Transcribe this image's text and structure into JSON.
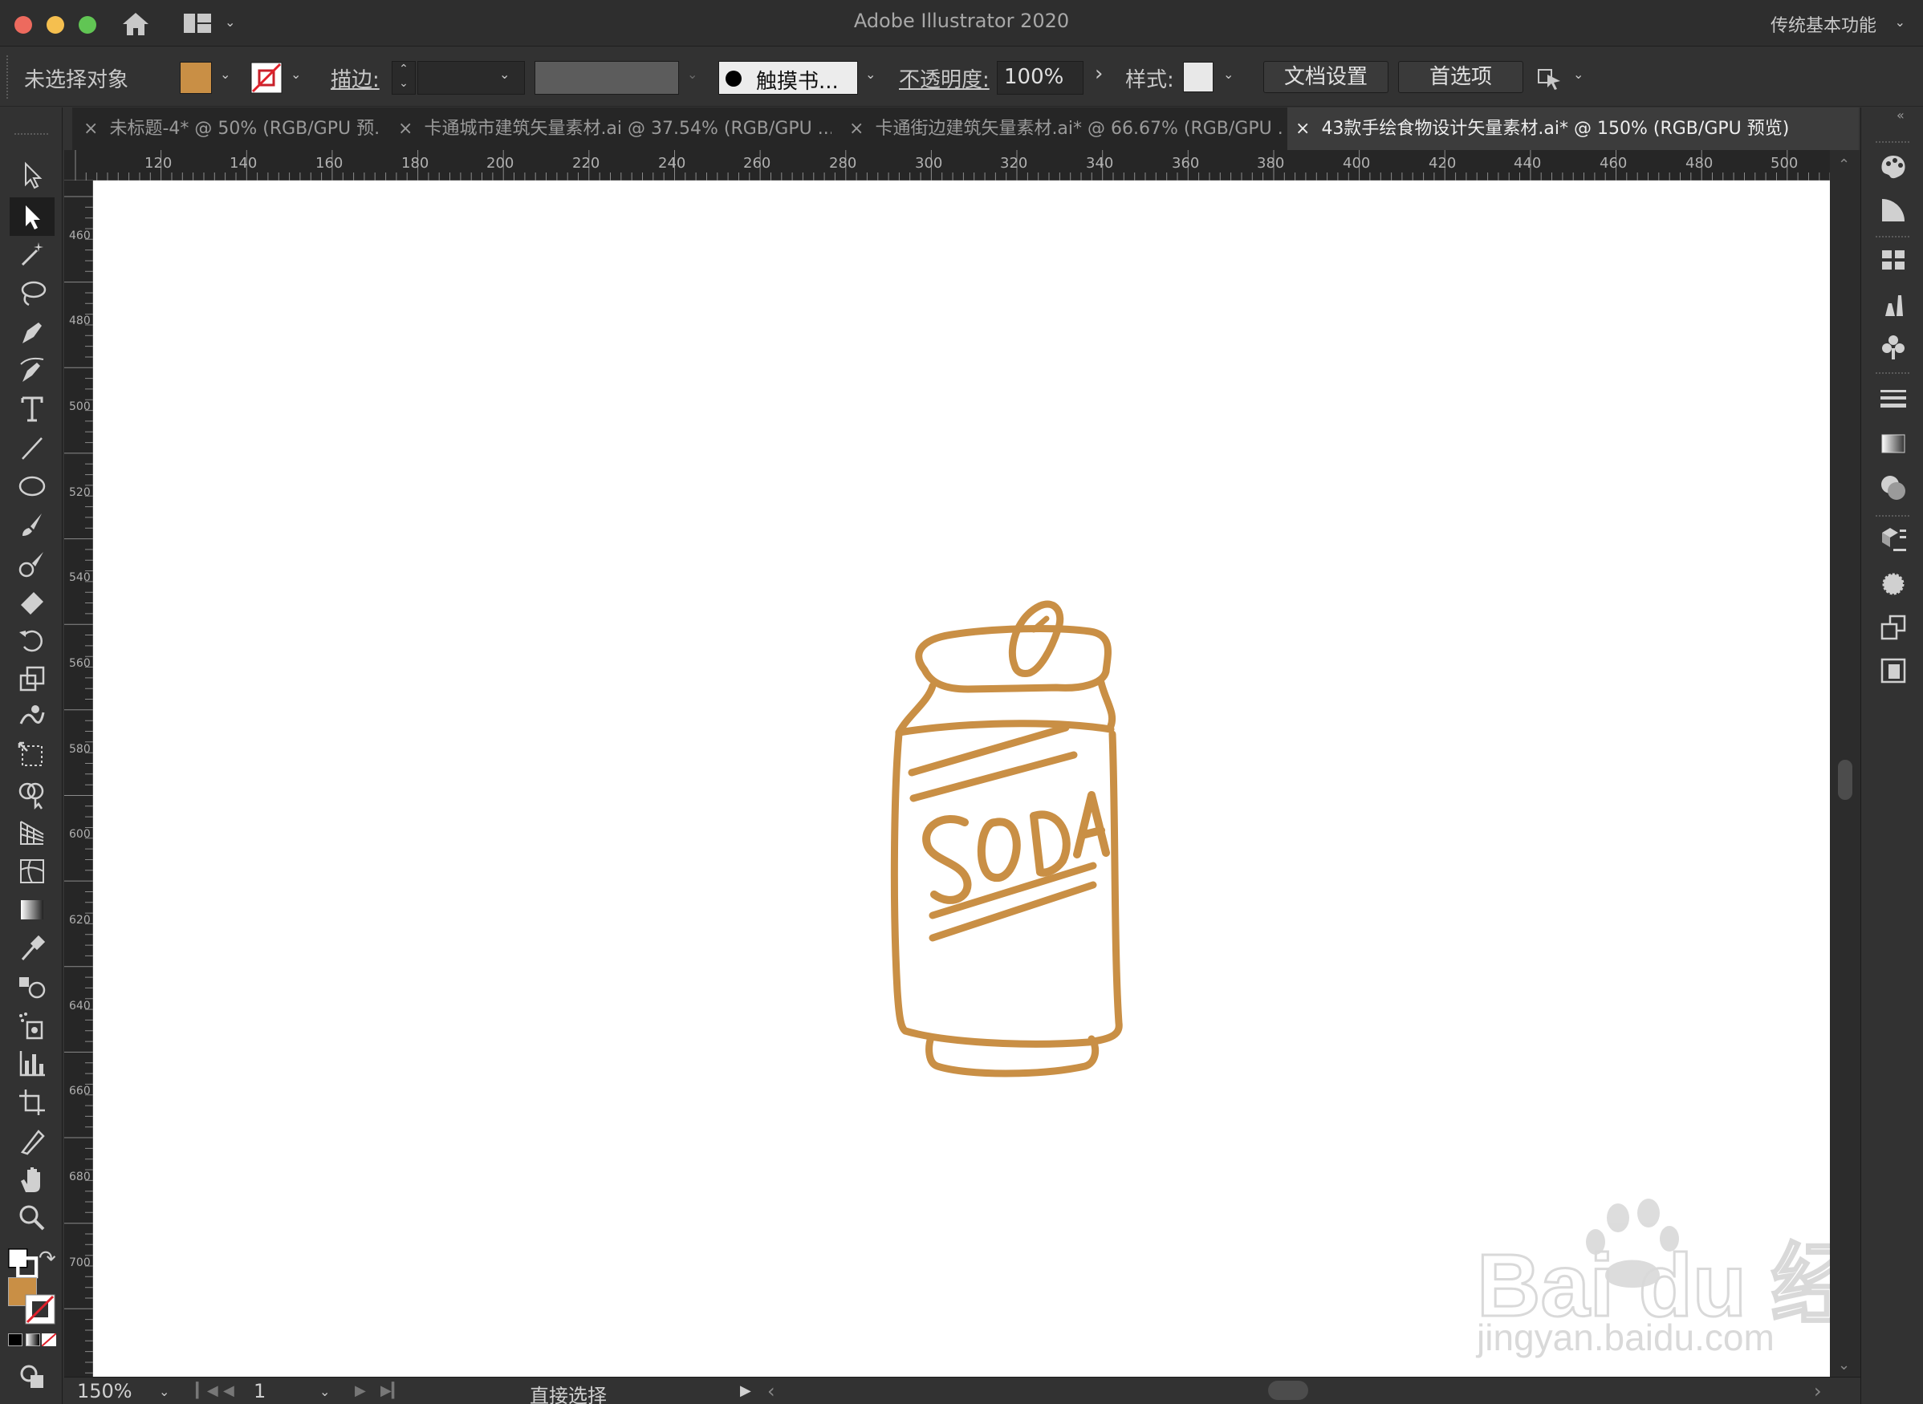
{
  "window": {
    "app_title": "Adobe Illustrator 2020",
    "workspace": "传统基本功能"
  },
  "control_bar": {
    "selection_status": "未选择对象",
    "fill_color": "#c98f45",
    "stroke_label": "描边:",
    "brush_label": "触摸书...",
    "opacity_label": "不透明度:",
    "opacity_value": "100%",
    "style_label": "样式:",
    "doc_setup_button": "文档设置",
    "preferences_button": "首选项"
  },
  "tabs": [
    {
      "label": "未标题-4* @ 50% (RGB/GPU 预...",
      "active": false
    },
    {
      "label": "卡通城市建筑矢量素材.ai @ 37.54% (RGB/GPU ...",
      "active": false
    },
    {
      "label": "卡通街边建筑矢量素材.ai* @ 66.67% (RGB/GPU ...",
      "active": false
    },
    {
      "label": "43款手绘食物设计矢量素材.ai* @ 150% (RGB/GPU 预览)",
      "active": true
    }
  ],
  "ruler": {
    "top_ticks": [
      "120",
      "140",
      "160",
      "180",
      "200",
      "220",
      "240",
      "260",
      "280",
      "300",
      "320",
      "340",
      "360",
      "380",
      "400",
      "420",
      "440",
      "460",
      "480",
      "500"
    ],
    "left_ticks": [
      "460",
      "480",
      "500",
      "520",
      "540",
      "560",
      "580",
      "600",
      "620",
      "640",
      "660",
      "680",
      "700"
    ]
  },
  "artwork": {
    "label": "SODA",
    "color": "#c98f45"
  },
  "tools": [
    "selection-tool",
    "direct-selection-tool",
    "magic-wand-tool",
    "lasso-tool",
    "pen-tool",
    "curvature-tool",
    "type-tool",
    "line-tool",
    "ellipse-tool",
    "paintbrush-tool",
    "blob-brush-tool",
    "eraser-tool",
    "rotate-tool",
    "scale-tool",
    "warp-tool",
    "free-transform-tool",
    "shape-builder-tool",
    "perspective-grid-tool",
    "mesh-tool",
    "gradient-tool",
    "eyedropper-tool",
    "blend-tool",
    "symbol-sprayer-tool",
    "column-graph-tool",
    "artboard-tool",
    "slice-tool",
    "hand-tool",
    "zoom-tool"
  ],
  "status_bar": {
    "zoom": "150%",
    "artboard_number": "1",
    "current_tool": "直接选择"
  },
  "watermark": {
    "brand": "Bai du 经验",
    "url": "jingyan.baidu.com"
  }
}
